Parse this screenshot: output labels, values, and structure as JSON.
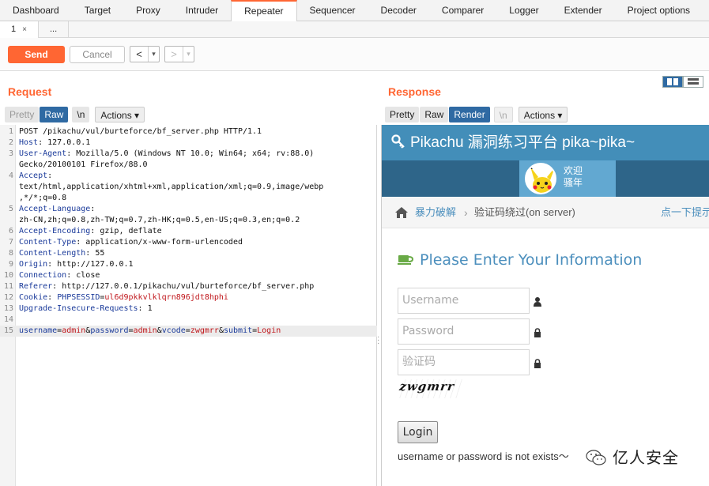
{
  "top_tabs": [
    "Dashboard",
    "Target",
    "Proxy",
    "Intruder",
    "Repeater",
    "Sequencer",
    "Decoder",
    "Comparer",
    "Logger",
    "Extender",
    "Project options",
    "U"
  ],
  "active_top_tab": "Repeater",
  "sub_tabs": [
    {
      "label": "1",
      "close": "×"
    },
    {
      "label": "..."
    }
  ],
  "toolbar": {
    "send": "Send",
    "cancel": "Cancel",
    "back": "<",
    "fwd": ">",
    "dd": "▾"
  },
  "request": {
    "title": "Request",
    "view_buttons": [
      "Pretty",
      "Raw",
      "\\n",
      "Actions ▾"
    ],
    "lines": [
      {
        "n": "1",
        "text": "POST /pikachu/vul/burteforce/bf_server.php HTTP/1.1"
      },
      {
        "n": "2",
        "name": "Host",
        "value": " 127.0.0.1"
      },
      {
        "n": "3",
        "name": "User-Agent",
        "value": " Mozilla/5.0 (Windows NT 10.0; Win64; x64; rv:88.0)"
      },
      {
        "n": "",
        "text": "Gecko/20100101 Firefox/88.0"
      },
      {
        "n": "4",
        "name": "Accept",
        "value": ""
      },
      {
        "n": "",
        "text": "text/html,application/xhtml+xml,application/xml;q=0.9,image/webp"
      },
      {
        "n": "",
        "text": ",*/*;q=0.8"
      },
      {
        "n": "5",
        "name": "Accept-Language",
        "value": ""
      },
      {
        "n": "",
        "text": "zh-CN,zh;q=0.8,zh-TW;q=0.7,zh-HK;q=0.5,en-US;q=0.3,en;q=0.2"
      },
      {
        "n": "6",
        "name": "Accept-Encoding",
        "value": " gzip, deflate"
      },
      {
        "n": "7",
        "name": "Content-Type",
        "value": " application/x-www-form-urlencoded"
      },
      {
        "n": "8",
        "name": "Content-Length",
        "value": " 55"
      },
      {
        "n": "9",
        "name": "Origin",
        "value": " http://127.0.0.1"
      },
      {
        "n": "10",
        "name": "Connection",
        "value": " close"
      },
      {
        "n": "11",
        "name": "Referer",
        "value": " http://127.0.0.1/pikachu/vul/burteforce/bf_server.php"
      },
      {
        "n": "12",
        "name": "Cookie",
        "value": " ",
        "cookie_name": "PHPSESSID",
        "cookie_value": "ul6d9pkkvlklqrn896jdt8hphi"
      },
      {
        "n": "13",
        "name": "Upgrade-Insecure-Requests",
        "value": " 1"
      },
      {
        "n": "14",
        "text": ""
      },
      {
        "n": "15",
        "body": [
          [
            "username",
            "admin"
          ],
          [
            "password",
            "admin"
          ],
          [
            "vcode",
            "zwgmrr"
          ],
          [
            "submit",
            "Login"
          ]
        ]
      }
    ]
  },
  "response": {
    "title": "Response",
    "view_buttons": [
      "Pretty",
      "Raw",
      "Render",
      "\\n",
      "Actions ▾"
    ],
    "page": {
      "header": "Pikachu 漏洞练习平台 pika~pika~",
      "welcome_line1": "欢迎",
      "welcome_line2": "骚年",
      "crumb_1": "暴力破解",
      "crumb_sep": "›",
      "crumb_2": "验证码绕过(on server)",
      "crumb_3": "点一下提示",
      "form_title": "Please Enter Your Information",
      "username_placeholder": "Username",
      "password_placeholder": "Password",
      "vcode_placeholder": "验证码",
      "captcha_text": "zwgmrr",
      "login_button": "Login",
      "message": "username or password is not exists～"
    }
  },
  "watermark": "亿人安全",
  "colors": {
    "accent": "#ff6633",
    "burp_blue": "#2f6aa3",
    "pk_header": "#438eb9",
    "pk_band": "#2e6589",
    "pk_link": "#4c8fbd"
  }
}
